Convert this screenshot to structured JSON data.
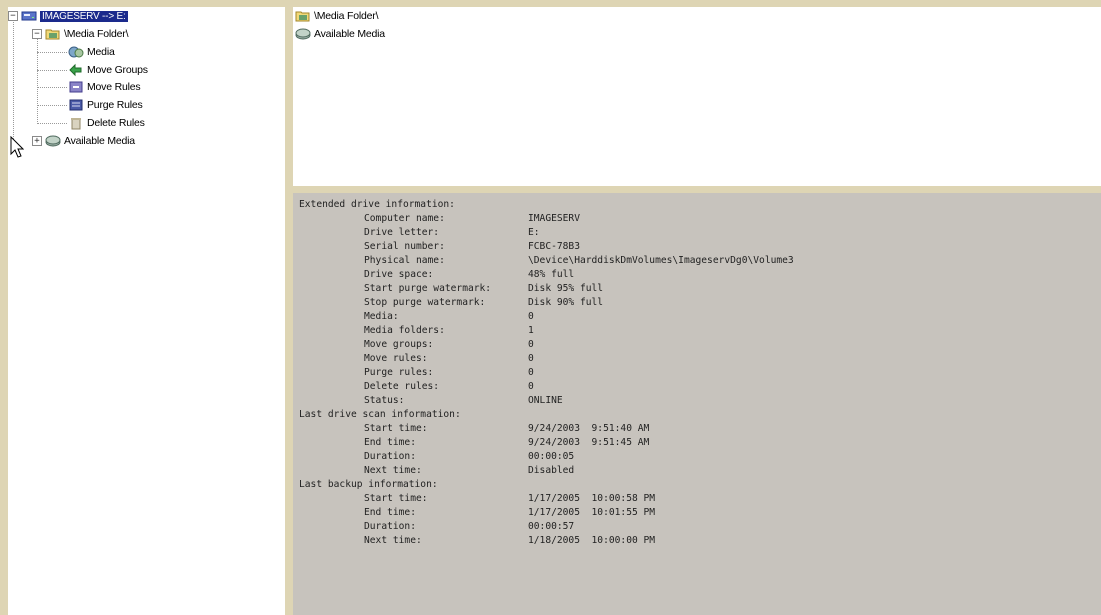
{
  "tree": {
    "root": {
      "label": "IMAGESERV --> E:",
      "expander": "−",
      "icon": "drive-icon"
    },
    "media_folder": {
      "label": "\\Media Folder\\",
      "expander": "−",
      "icon": "folder-icon"
    },
    "children": [
      {
        "label": "Media",
        "icon": "media-icon"
      },
      {
        "label": "Move Groups",
        "icon": "move-groups-icon"
      },
      {
        "label": "Move Rules",
        "icon": "move-rules-icon"
      },
      {
        "label": "Purge Rules",
        "icon": "purge-rules-icon"
      },
      {
        "label": "Delete Rules",
        "icon": "delete-rules-icon"
      }
    ],
    "available_media": {
      "label": "Available Media",
      "expander": "+",
      "icon": "available-media-icon"
    }
  },
  "list": {
    "items": [
      {
        "label": "\\Media Folder\\",
        "icon": "folder-icon"
      },
      {
        "label": "Available Media",
        "icon": "available-media-icon"
      }
    ]
  },
  "info": {
    "sections": [
      {
        "header": "Extended drive information:",
        "rows": [
          {
            "key": "Computer name:",
            "value": "IMAGESERV"
          },
          {
            "key": "Drive letter:",
            "value": "E:"
          },
          {
            "key": "Serial number:",
            "value": "FCBC-78B3"
          },
          {
            "key": "Physical name:",
            "value": "\\Device\\HarddiskDmVolumes\\ImageservDg0\\Volume3"
          },
          {
            "key": "Drive space:",
            "value": "48% full"
          },
          {
            "key": "Start purge watermark:",
            "value": "Disk 95% full"
          },
          {
            "key": "Stop purge watermark:",
            "value": "Disk 90% full"
          },
          {
            "key": "Media:",
            "value": "0"
          },
          {
            "key": "Media folders:",
            "value": "1"
          },
          {
            "key": "Move groups:",
            "value": "0"
          },
          {
            "key": "Move rules:",
            "value": "0"
          },
          {
            "key": "Purge rules:",
            "value": "0"
          },
          {
            "key": "Delete rules:",
            "value": "0"
          },
          {
            "key": "Status:",
            "value": "ONLINE"
          }
        ]
      },
      {
        "header": "Last drive scan information:",
        "rows": [
          {
            "key": "Start time:",
            "value": "9/24/2003  9:51:40 AM"
          },
          {
            "key": "End time:",
            "value": "9/24/2003  9:51:45 AM"
          },
          {
            "key": "Duration:",
            "value": "00:00:05"
          },
          {
            "key": "Next time:",
            "value": "Disabled"
          }
        ]
      },
      {
        "header": "Last backup information:",
        "rows": [
          {
            "key": "Start time:",
            "value": "1/17/2005  10:00:58 PM"
          },
          {
            "key": "End time:",
            "value": "1/17/2005  10:01:55 PM"
          },
          {
            "key": "Duration:",
            "value": "00:00:57"
          },
          {
            "key": "Next time:",
            "value": "1/18/2005  10:00:00 PM"
          }
        ]
      }
    ]
  },
  "colors": {
    "frame": "#ded5b4",
    "info_background": "#c7c3bd",
    "selection": "#1b2a8c"
  }
}
